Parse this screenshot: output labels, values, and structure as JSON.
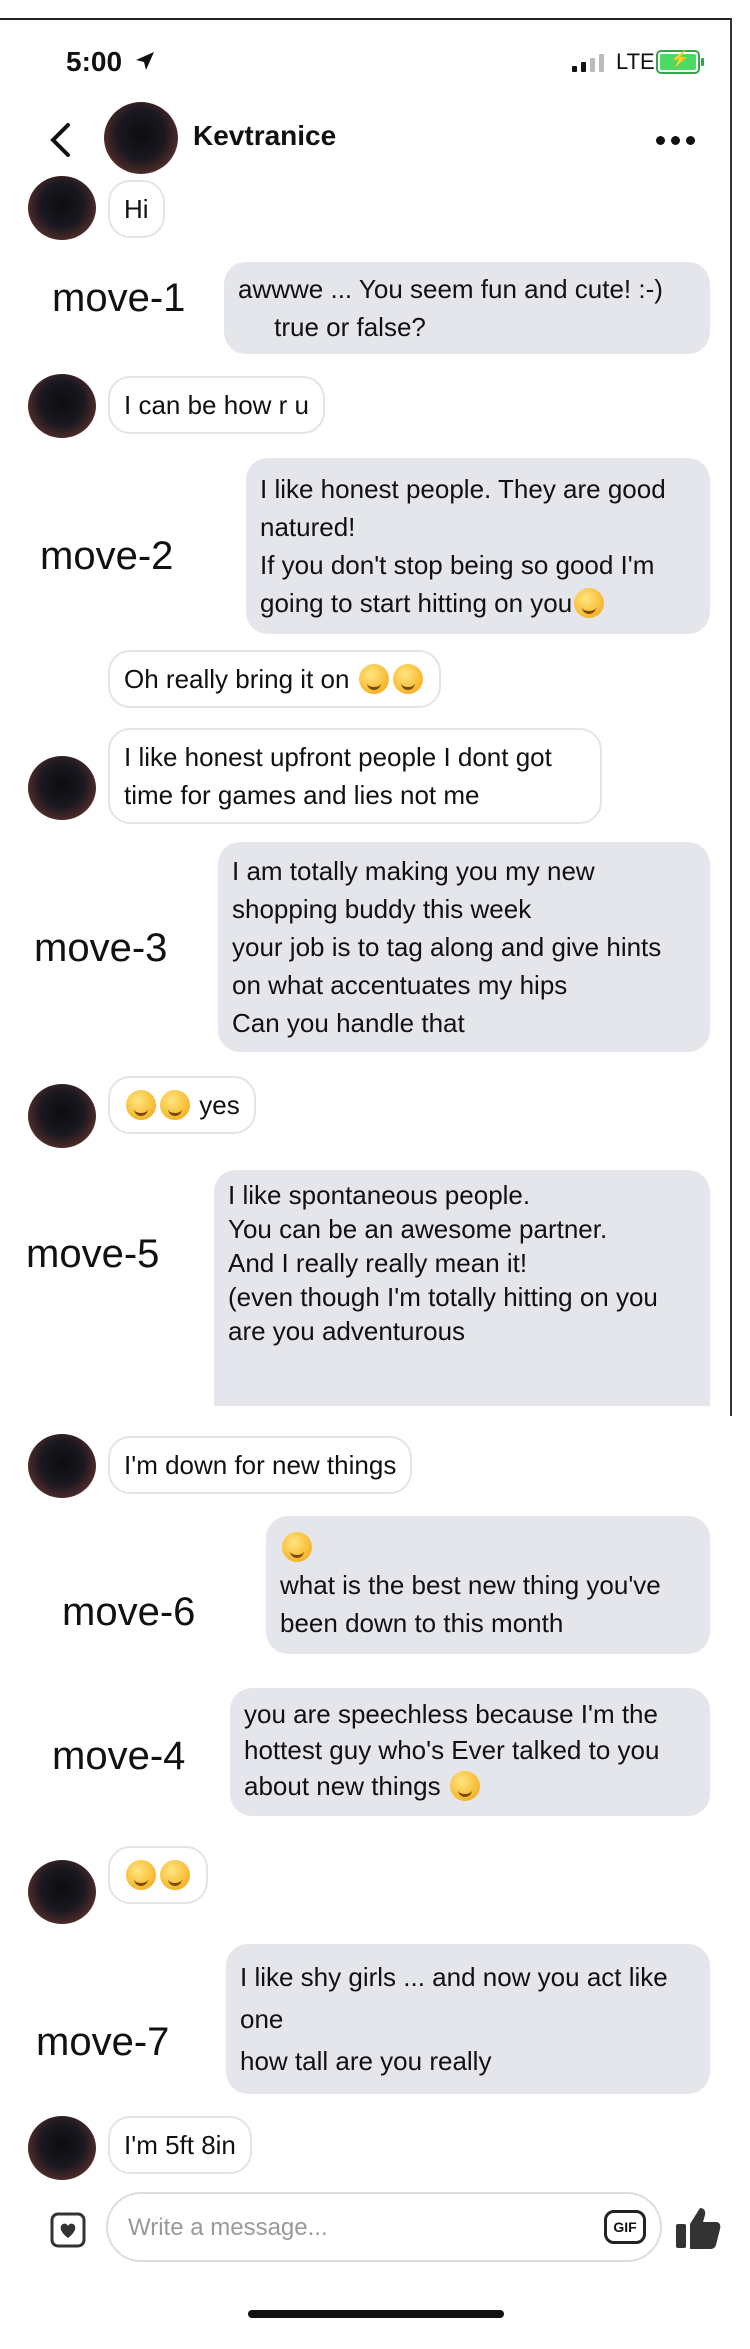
{
  "status": {
    "time": "5:00",
    "network": "LTE"
  },
  "header": {
    "contact_name": "Kevtranice"
  },
  "messages": [
    {
      "dir": "in",
      "text": "Hi"
    },
    {
      "dir": "out",
      "move": "move-1",
      "text": "awwwe ... You seem fun and cute! :-)\n     true or false?"
    },
    {
      "dir": "in",
      "text": "I can be how r u"
    },
    {
      "dir": "out",
      "move": "move-2",
      "text": "I like honest people. They are good natured!\nIf you don't stop being so good I'm going to start hitting on you"
    },
    {
      "dir": "in",
      "text": "Oh really bring it on"
    },
    {
      "dir": "in",
      "text": "I like honest upfront people I dont got time for games and lies not me"
    },
    {
      "dir": "out",
      "move": "move-3",
      "text": "I am totally making you my new shopping buddy this week\nyour job is to tag along and give hints on what accentuates my hips\nCan you handle that"
    },
    {
      "dir": "in",
      "text": "yes"
    },
    {
      "dir": "out",
      "move": "move-5",
      "text": "I like spontaneous people.\nYou can be an awesome partner.\nAnd I really really mean it!\n(even though I'm totally hitting on you\nare you adventurous"
    },
    {
      "dir": "in",
      "text": "I'm down for new things"
    },
    {
      "dir": "out",
      "move": "move-6",
      "text": "what is the best new thing you've been down to this month"
    },
    {
      "dir": "out",
      "move": "move-4",
      "text": "you are speechless because I'm the hottest guy who's Ever talked to you about new things"
    },
    {
      "dir": "in",
      "text": ""
    },
    {
      "dir": "out",
      "move": "move-7",
      "text": "I like shy girls ... and now you act like one\nhow tall are you really"
    },
    {
      "dir": "in",
      "text": "I'm 5ft 8in"
    }
  ],
  "composer": {
    "placeholder": "Write a message...",
    "gif_label": "GIF"
  }
}
